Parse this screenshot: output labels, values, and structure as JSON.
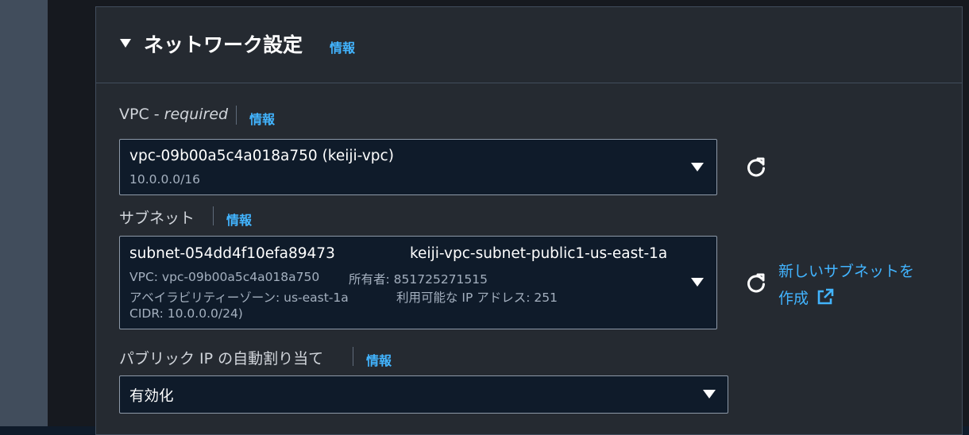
{
  "section": {
    "title": "ネットワーク設定",
    "info": "情報"
  },
  "vpc": {
    "label": "VPC - ",
    "required": "required",
    "info": "情報",
    "selected": "vpc-09b00a5c4a018a750 (keiji-vpc)",
    "cidr": "10.0.0.0/16"
  },
  "subnet": {
    "label": "サブネット",
    "info": "情報",
    "selected_id": "subnet-054dd4f10efa89473",
    "selected_name": "keiji-vpc-subnet-public1-us-east-1a",
    "line2_vpc": "VPC: vpc-09b00a5c4a018a750",
    "line2_owner": "所有者: 851725271515",
    "line3_az": "アベイラビリティーゾーン: us-east-1a",
    "line3_ip": "利用可能な IP アドレス: 251",
    "line4_cidr": "CIDR: 10.0.0.0/24)",
    "create_link_1": "新しいサブネットを",
    "create_link_2": "作成"
  },
  "public_ip": {
    "label": "パブリック IP の自動割り当て",
    "info": "情報",
    "selected": "有効化"
  },
  "icons": {
    "caret": "caret-down-icon",
    "dropdown": "chevron-down-icon",
    "refresh": "refresh-icon",
    "external": "external-link-icon"
  },
  "colors": {
    "link": "#42b4ff",
    "panel_bg": "#252a31",
    "input_bg": "#0f1b2a"
  }
}
